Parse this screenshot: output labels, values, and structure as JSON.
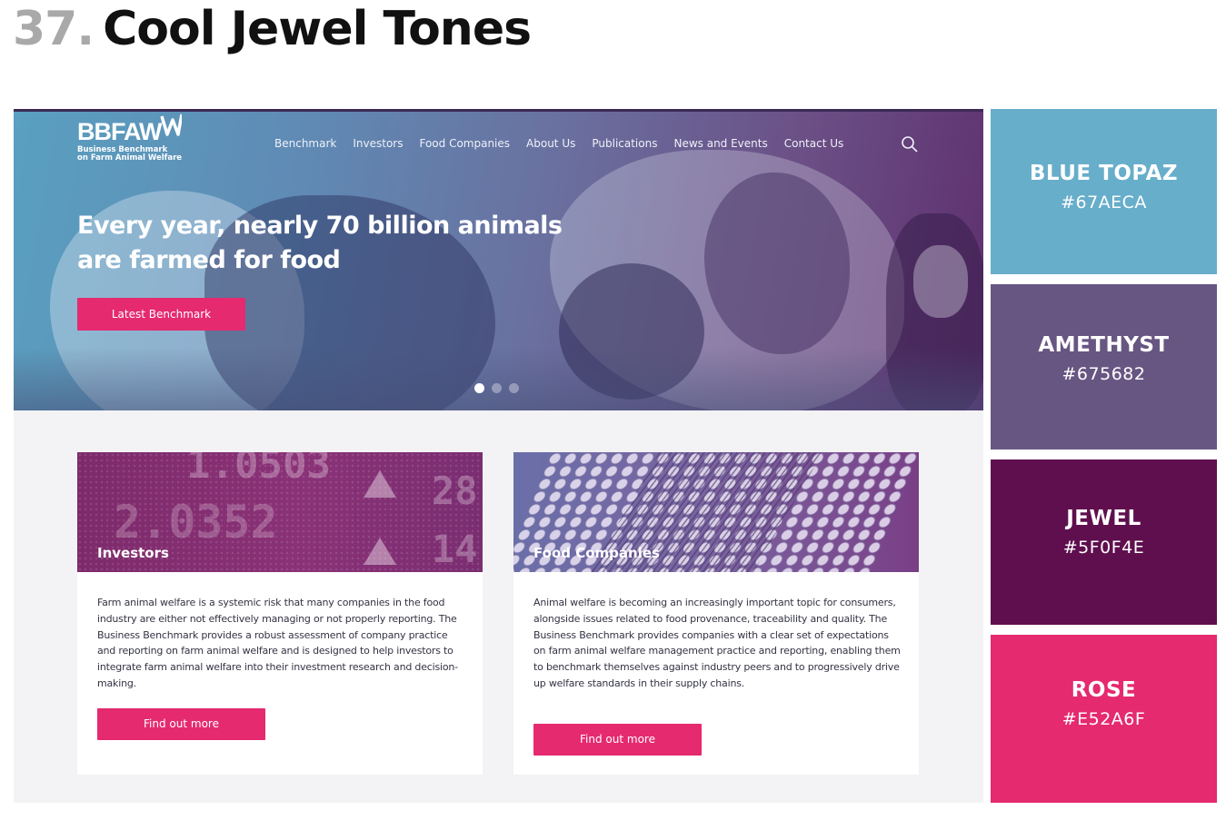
{
  "page": {
    "number": "37.",
    "title": "Cool Jewel Tones"
  },
  "site": {
    "logo": {
      "text": "BBFAW",
      "sub1": "Business Benchmark",
      "sub2": "on Farm Animal Welfare"
    },
    "nav": [
      "Benchmark",
      "Investors",
      "Food Companies",
      "About Us",
      "Publications",
      "News and Events",
      "Contact Us"
    ],
    "search_icon": "search-icon",
    "hero": {
      "headline": "Every year, nearly 70 billion animals are farmed for food",
      "button": "Latest Benchmark",
      "slides": 3,
      "active_slide": 1
    },
    "cards": [
      {
        "title": "Investors",
        "image_text": [
          "1.0503",
          "2.0352",
          "28",
          "14"
        ],
        "text": "Farm animal welfare is a systemic risk that many companies in the food industry are either not effectively managing or not properly reporting. The Business Benchmark provides a robust assessment of company practice and reporting on farm animal welfare and is designed to help investors to integrate farm animal welfare into their investment research and decision-making.",
        "button": "Find out more"
      },
      {
        "title": "Food Companies",
        "text": "Animal welfare is becoming an increasingly important topic for consumers, alongside issues related to food provenance, traceability and quality. The Business Benchmark provides companies with a clear set of expectations on farm animal welfare management practice and reporting, enabling them to benchmark themselves against industry peers and to progressively drive up welfare standards in their supply chains.",
        "button": "Find out more"
      }
    ]
  },
  "palette": [
    {
      "name": "BLUE TOPAZ",
      "hex": "#67AECA",
      "color": "#67aeca"
    },
    {
      "name": "AMETHYST",
      "hex": "#675682",
      "color": "#675682"
    },
    {
      "name": "JEWEL",
      "hex": "#5F0F4E",
      "color": "#5f0f4e"
    },
    {
      "name": "ROSE",
      "hex": "#E52A6F",
      "color": "#e52a6f"
    }
  ]
}
